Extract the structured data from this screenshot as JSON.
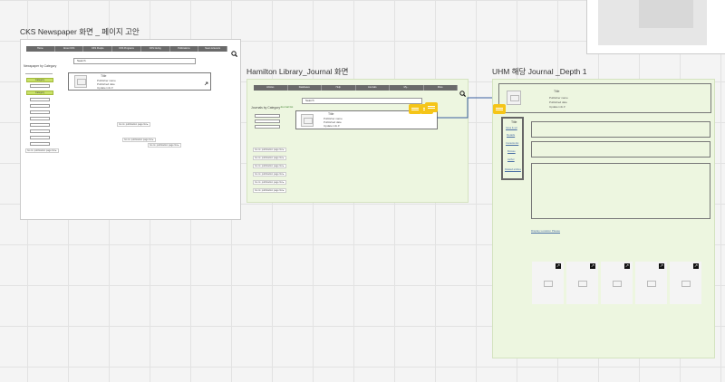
{
  "frames": {
    "cks": {
      "title": "CKS Newspaper 화면 _ 페이지 고안"
    },
    "hamilton": {
      "title": "Hamilton Library_Journal 화면"
    },
    "uhm": {
      "title": "UHM 해당 Journal _Depth 1"
    }
  },
  "cks": {
    "nav": [
      "Home",
      "About CKS",
      "CKS People",
      "CKS Programs",
      "CKS Giving",
      "Publications",
      "News & Events"
    ],
    "search_placeholder": "Search",
    "category_label": "Newspaper by Category",
    "categories": [
      "",
      "Category",
      "",
      "Category",
      "",
      "",
      "",
      "",
      "",
      "",
      ""
    ],
    "card": {
      "title": "Title",
      "line1": "Publisher name",
      "line2": "Published date",
      "more": "Update info ▾"
    },
    "connectors": [
      "Go to: publication page list ▸",
      "Go to: publication page list ▸",
      "Go to: publication page list ▸",
      "Go to: publication page list ▸"
    ]
  },
  "hamilton": {
    "nav": [
      "Articles",
      "Databases",
      "Help",
      "Journals",
      "My...",
      "More"
    ],
    "search_placeholder": "Search",
    "category_label": "Journals by Category",
    "card_label": "Journal list",
    "card": {
      "title": "Title",
      "line1": "Publisher name",
      "line2": "Published date",
      "more": "Update info ▾"
    },
    "connectors": [
      "Go to: publication page list ▸",
      "Go to: publication page list ▸",
      "Go to: publication page list ▸",
      "Go to: publication page list ▸",
      "Go to: publication page list ▸",
      "Go to: publication page list ▸"
    ]
  },
  "uhm": {
    "header": {
      "title": "Title",
      "line1": "Publisher name",
      "line2": "Published date",
      "more": "Update info ▾"
    },
    "sidebar": [
      "Title",
      "Issue & vol",
      "Details",
      "Contents list",
      "Browse",
      "Author",
      "Related articles"
    ],
    "display_link": "Display Location Please"
  },
  "colors": {
    "frame_bg": "#edf6e0",
    "accent": "#c8e068",
    "comment": "#f5c518",
    "navbar": "#6a6a6a"
  }
}
